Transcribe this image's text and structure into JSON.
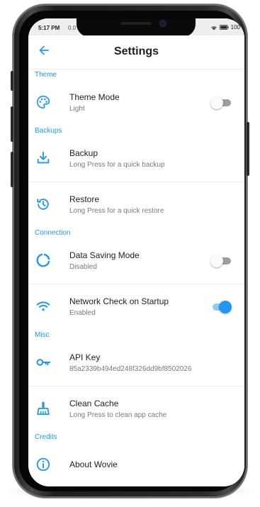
{
  "status_bar": {
    "time": "5:17 PM",
    "extra": "0.0",
    "battery": "100"
  },
  "app_bar": {
    "title": "Settings",
    "back_icon": "arrow-left-icon"
  },
  "colors": {
    "accent": "#2196f3",
    "section_label": "#2196f3",
    "text_primary": "#212121",
    "text_secondary": "#7a7a7a"
  },
  "sections": {
    "theme": {
      "label": "Theme",
      "theme_mode": {
        "title": "Theme Mode",
        "subtitle": "Light",
        "icon": "palette-icon",
        "toggle_on": false
      }
    },
    "backups": {
      "label": "Backups",
      "backup": {
        "title": "Backup",
        "subtitle": "Long Press for a quick backup",
        "icon": "download-icon"
      },
      "restore": {
        "title": "Restore",
        "subtitle": "Long Press for a quick restore",
        "icon": "restore-icon"
      }
    },
    "connection": {
      "label": "Connection",
      "data_saving": {
        "title": "Data Saving Mode",
        "subtitle": "Disabled",
        "icon": "data-saving-icon",
        "toggle_on": false
      },
      "network_check": {
        "title": "Network Check on Startup",
        "subtitle": "Enabled",
        "icon": "wifi-icon",
        "toggle_on": true
      }
    },
    "misc": {
      "label": "Misc",
      "api_key": {
        "title": "API Key",
        "subtitle": "85a2339b494ed248f326dd9bf8502026",
        "icon": "key-icon"
      },
      "clean_cache": {
        "title": "Clean Cache",
        "subtitle": "Long Press to clean app cache",
        "icon": "broom-icon"
      }
    },
    "credits": {
      "label": "Credits",
      "about": {
        "title": "About Wovie",
        "icon": "info-icon"
      }
    }
  }
}
